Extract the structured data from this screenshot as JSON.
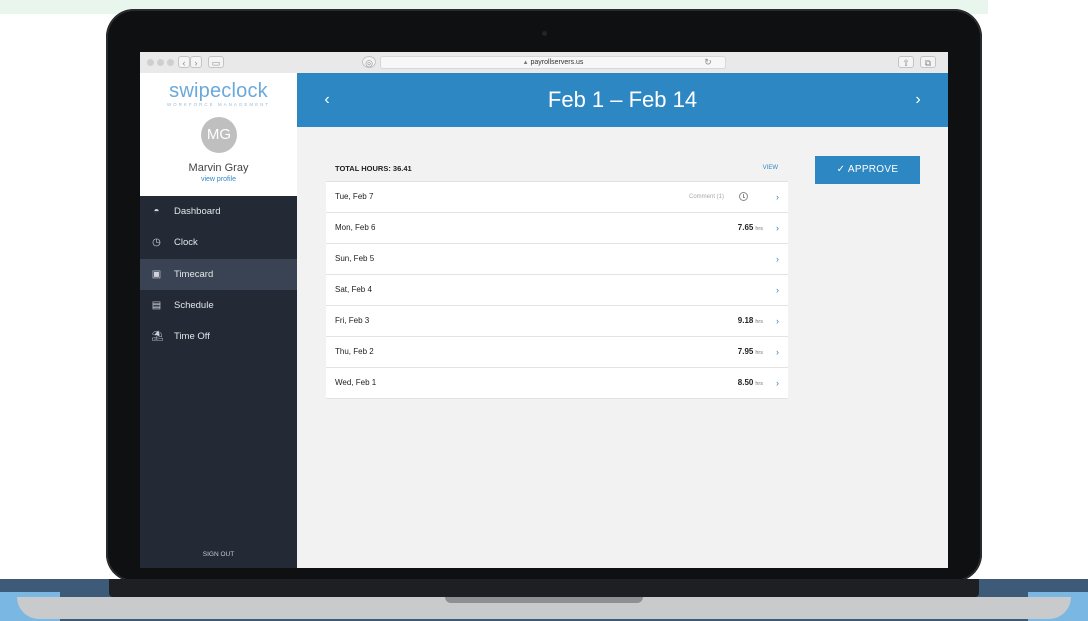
{
  "browser": {
    "url": "payrollservers.us",
    "back": "‹",
    "forward": "›"
  },
  "brand": {
    "logo": "swipeclock",
    "subtitle": "WORKFORCE MANAGEMENT"
  },
  "user": {
    "initials": "MG",
    "name": "Marvin Gray",
    "profile_link": "view profile"
  },
  "sidebar": {
    "items": [
      {
        "label": "Dashboard",
        "icon": "dashboard-icon"
      },
      {
        "label": "Clock",
        "icon": "clock-icon"
      },
      {
        "label": "Timecard",
        "icon": "timecard-icon",
        "active": true
      },
      {
        "label": "Schedule",
        "icon": "calendar-icon"
      },
      {
        "label": "Time Off",
        "icon": "beach-icon"
      }
    ],
    "sign_out": "SIGN OUT"
  },
  "header": {
    "prev": "‹",
    "title": "Feb 1 – Feb 14",
    "next": "›"
  },
  "timecard": {
    "total": "TOTAL HOURS: 36.41",
    "view": "VIEW",
    "hours_unit": "hrs",
    "rows": [
      {
        "day": "Tue, Feb 7",
        "hours": "",
        "comment": "Comment (1)"
      },
      {
        "day": "Mon, Feb 6",
        "hours": "7.65",
        "comment": ""
      },
      {
        "day": "Sun, Feb 5",
        "hours": "",
        "comment": ""
      },
      {
        "day": "Sat, Feb 4",
        "hours": "",
        "comment": ""
      },
      {
        "day": "Fri, Feb 3",
        "hours": "9.18",
        "comment": ""
      },
      {
        "day": "Thu, Feb 2",
        "hours": "7.95",
        "comment": ""
      },
      {
        "day": "Wed, Feb 1",
        "hours": "8.50",
        "comment": ""
      }
    ]
  },
  "approve_label": "✓  APPROVE",
  "colors": {
    "accent": "#2d87c3",
    "sidebar": "#232a36",
    "sidebar_active": "#394353"
  }
}
